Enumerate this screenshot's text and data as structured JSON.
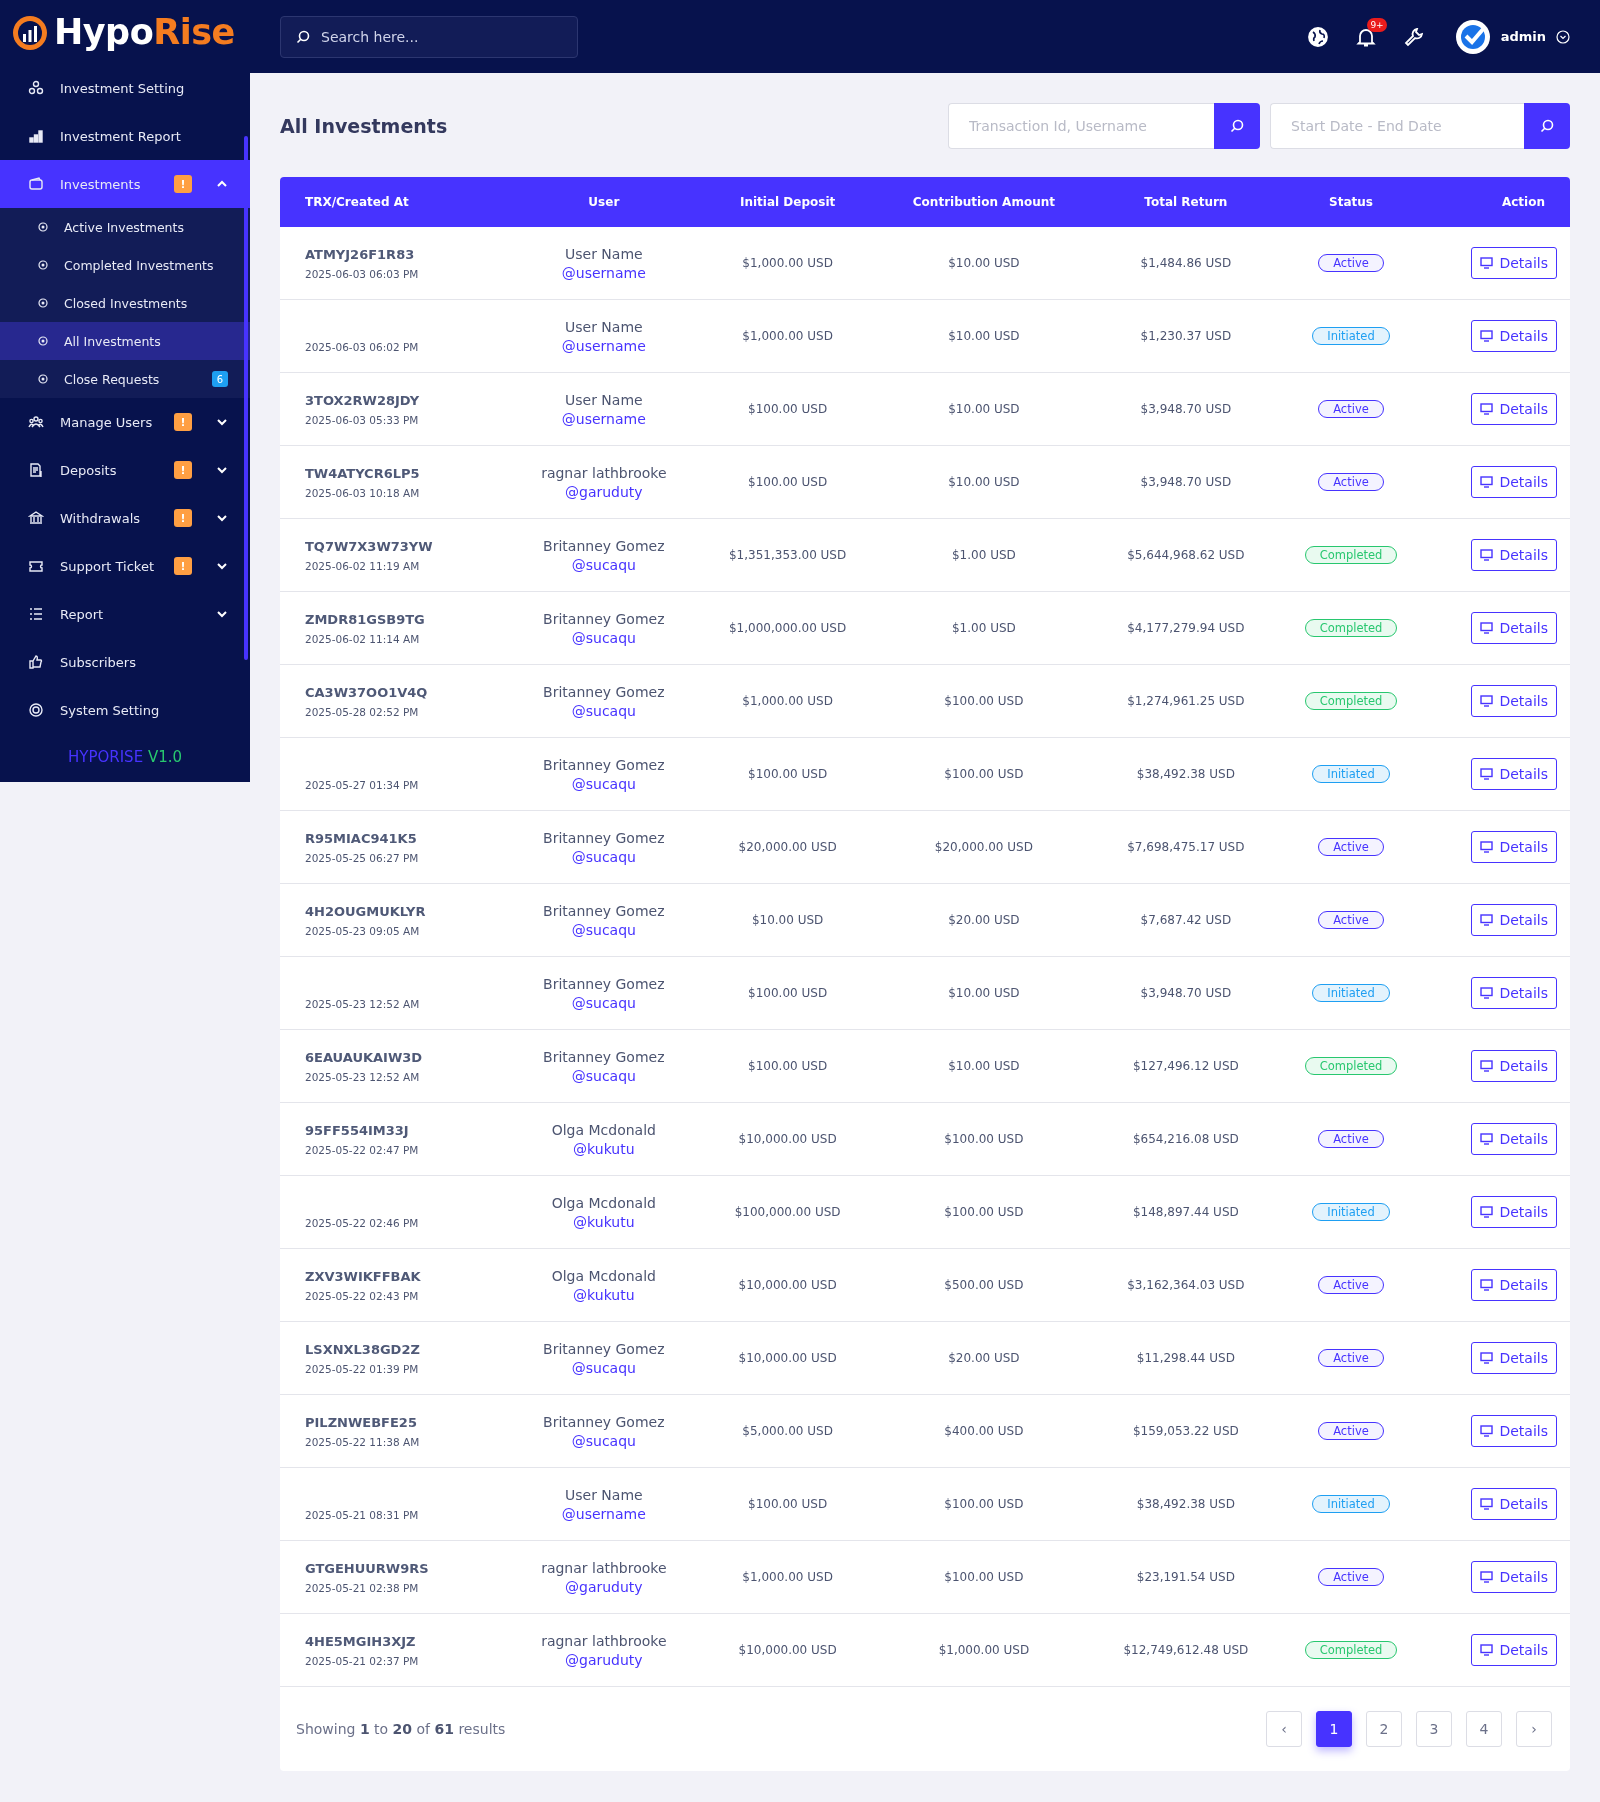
{
  "brand": {
    "part1": "Hypo",
    "part2": "Rise"
  },
  "sidebar": {
    "items": [
      {
        "label": "Investment Setting",
        "selected": false
      },
      {
        "label": "Investment Report",
        "selected": false
      },
      {
        "label": "Investments",
        "selected": true,
        "badge": "!",
        "expanded": true,
        "children": [
          {
            "label": "Active Investments",
            "selected": false
          },
          {
            "label": "Completed Investments",
            "selected": false
          },
          {
            "label": "Closed Investments",
            "selected": false
          },
          {
            "label": "All Investments",
            "selected": true
          },
          {
            "label": "Close Requests",
            "selected": false,
            "badge": "6"
          }
        ]
      },
      {
        "label": "Manage Users",
        "selected": false,
        "badge": "!",
        "expanded": false
      },
      {
        "label": "Deposits",
        "selected": false,
        "badge": "!",
        "expanded": false
      },
      {
        "label": "Withdrawals",
        "selected": false,
        "badge": "!",
        "expanded": false
      },
      {
        "label": "Support Ticket",
        "selected": false,
        "badge": "!",
        "expanded": false
      },
      {
        "label": "Report",
        "selected": false,
        "expanded": false
      },
      {
        "label": "Subscribers",
        "selected": false
      },
      {
        "label": "System Setting",
        "selected": false
      }
    ],
    "version": {
      "name": "HYPORISE",
      "number": "V1.0"
    }
  },
  "topbar": {
    "search": {
      "placeholder": "Search here..."
    },
    "notification_count": "9+",
    "user": "admin"
  },
  "page_title": "All Investments",
  "filters": [
    {
      "placeholder": "Transaction Id, Username"
    },
    {
      "placeholder": "Start Date - End Date"
    }
  ],
  "table": {
    "columns": [
      "TRX/Created At",
      "User",
      "Initial Deposit",
      "Contribution Amount",
      "Total Return",
      "Status",
      "Action"
    ],
    "rows": [
      {
        "trx": "ATMYJ26F1R83",
        "date": "2025-06-03 06:03 PM",
        "name": "User Name",
        "username": "@username",
        "deposit": "$1,000.00 USD",
        "contribution": "$10.00 USD",
        "total": "$1,484.86 USD",
        "status": "Active",
        "kind": "active",
        "action": "Details"
      },
      {
        "date": "2025-06-03 06:02 PM",
        "name": "User Name",
        "username": "@username",
        "deposit": "$1,000.00 USD",
        "contribution": "$10.00 USD",
        "total": "$1,230.37 USD",
        "status": "Initiated",
        "kind": "initiated",
        "action": "Details"
      },
      {
        "trx": "3TOX2RW28JDY",
        "date": "2025-06-03 05:33 PM",
        "name": "User Name",
        "username": "@username",
        "deposit": "$100.00 USD",
        "contribution": "$10.00 USD",
        "total": "$3,948.70 USD",
        "status": "Active",
        "kind": "active",
        "action": "Details"
      },
      {
        "trx": "TW4ATYCR6LP5",
        "date": "2025-06-03 10:18 AM",
        "name": "ragnar lathbrooke",
        "username": "@garuduty",
        "deposit": "$100.00 USD",
        "contribution": "$10.00 USD",
        "total": "$3,948.70 USD",
        "status": "Active",
        "kind": "active",
        "action": "Details"
      },
      {
        "trx": "TQ7W7X3W73YW",
        "date": "2025-06-02 11:19 AM",
        "name": "Britanney Gomez",
        "username": "@sucaqu",
        "deposit": "$1,351,353.00 USD",
        "contribution": "$1.00 USD",
        "total": "$5,644,968.62 USD",
        "status": "Completed",
        "kind": "completed",
        "action": "Details"
      },
      {
        "trx": "ZMDR81GSB9TG",
        "date": "2025-06-02 11:14 AM",
        "name": "Britanney Gomez",
        "username": "@sucaqu",
        "deposit": "$1,000,000.00 USD",
        "contribution": "$1.00 USD",
        "total": "$4,177,279.94 USD",
        "status": "Completed",
        "kind": "completed",
        "action": "Details"
      },
      {
        "trx": "CA3W37OO1V4Q",
        "date": "2025-05-28 02:52 PM",
        "name": "Britanney Gomez",
        "username": "@sucaqu",
        "deposit": "$1,000.00 USD",
        "contribution": "$100.00 USD",
        "total": "$1,274,961.25 USD",
        "status": "Completed",
        "kind": "completed",
        "action": "Details"
      },
      {
        "date": "2025-05-27 01:34 PM",
        "name": "Britanney Gomez",
        "username": "@sucaqu",
        "deposit": "$100.00 USD",
        "contribution": "$100.00 USD",
        "total": "$38,492.38 USD",
        "status": "Initiated",
        "kind": "initiated",
        "action": "Details"
      },
      {
        "trx": "R95MIAC941K5",
        "date": "2025-05-25 06:27 PM",
        "name": "Britanney Gomez",
        "username": "@sucaqu",
        "deposit": "$20,000.00 USD",
        "contribution": "$20,000.00 USD",
        "total": "$7,698,475.17 USD",
        "status": "Active",
        "kind": "active",
        "action": "Details"
      },
      {
        "trx": "4H2OUGMUKLYR",
        "date": "2025-05-23 09:05 AM",
        "name": "Britanney Gomez",
        "username": "@sucaqu",
        "deposit": "$10.00 USD",
        "contribution": "$20.00 USD",
        "total": "$7,687.42 USD",
        "status": "Active",
        "kind": "active",
        "action": "Details"
      },
      {
        "date": "2025-05-23 12:52 AM",
        "name": "Britanney Gomez",
        "username": "@sucaqu",
        "deposit": "$100.00 USD",
        "contribution": "$10.00 USD",
        "total": "$3,948.70 USD",
        "status": "Initiated",
        "kind": "initiated",
        "action": "Details"
      },
      {
        "trx": "6EAUAUKAIW3D",
        "date": "2025-05-23 12:52 AM",
        "name": "Britanney Gomez",
        "username": "@sucaqu",
        "deposit": "$100.00 USD",
        "contribution": "$10.00 USD",
        "total": "$127,496.12 USD",
        "status": "Completed",
        "kind": "completed",
        "action": "Details"
      },
      {
        "trx": "95FF554IM33J",
        "date": "2025-05-22 02:47 PM",
        "name": "Olga Mcdonald",
        "username": "@kukutu",
        "deposit": "$10,000.00 USD",
        "contribution": "$100.00 USD",
        "total": "$654,216.08 USD",
        "status": "Active",
        "kind": "active",
        "action": "Details"
      },
      {
        "date": "2025-05-22 02:46 PM",
        "name": "Olga Mcdonald",
        "username": "@kukutu",
        "deposit": "$100,000.00 USD",
        "contribution": "$100.00 USD",
        "total": "$148,897.44 USD",
        "status": "Initiated",
        "kind": "initiated",
        "action": "Details"
      },
      {
        "trx": "ZXV3WIKFFBAK",
        "date": "2025-05-22 02:43 PM",
        "name": "Olga Mcdonald",
        "username": "@kukutu",
        "deposit": "$10,000.00 USD",
        "contribution": "$500.00 USD",
        "total": "$3,162,364.03 USD",
        "status": "Active",
        "kind": "active",
        "action": "Details"
      },
      {
        "trx": "LSXNXL38GD2Z",
        "date": "2025-05-22 01:39 PM",
        "name": "Britanney Gomez",
        "username": "@sucaqu",
        "deposit": "$10,000.00 USD",
        "contribution": "$20.00 USD",
        "total": "$11,298.44 USD",
        "status": "Active",
        "kind": "active",
        "action": "Details"
      },
      {
        "trx": "PILZNWEBFE25",
        "date": "2025-05-22 11:38 AM",
        "name": "Britanney Gomez",
        "username": "@sucaqu",
        "deposit": "$5,000.00 USD",
        "contribution": "$400.00 USD",
        "total": "$159,053.22 USD",
        "status": "Active",
        "kind": "active",
        "action": "Details"
      },
      {
        "date": "2025-05-21 08:31 PM",
        "name": "User Name",
        "username": "@username",
        "deposit": "$100.00 USD",
        "contribution": "$100.00 USD",
        "total": "$38,492.38 USD",
        "status": "Initiated",
        "kind": "initiated",
        "action": "Details"
      },
      {
        "trx": "GTGEHUURW9RS",
        "date": "2025-05-21 02:38 PM",
        "name": "ragnar lathbrooke",
        "username": "@garuduty",
        "deposit": "$1,000.00 USD",
        "contribution": "$100.00 USD",
        "total": "$23,191.54 USD",
        "status": "Active",
        "kind": "active",
        "action": "Details"
      },
      {
        "trx": "4HE5MGIH3XJZ",
        "date": "2025-05-21 02:37 PM",
        "name": "ragnar lathbrooke",
        "username": "@garuduty",
        "deposit": "$10,000.00 USD",
        "contribution": "$1,000.00 USD",
        "total": "$12,749,612.48 USD",
        "status": "Completed",
        "kind": "completed",
        "action": "Details"
      }
    ]
  },
  "summary": "Showing **1** to **20** of **61** results",
  "pagination": [
    {
      "label": "‹",
      "selected": false
    },
    {
      "label": "1",
      "selected": true
    },
    {
      "label": "2",
      "selected": false
    },
    {
      "label": "3",
      "selected": false
    },
    {
      "label": "4",
      "selected": false
    },
    {
      "label": "›",
      "selected": false
    }
  ]
}
